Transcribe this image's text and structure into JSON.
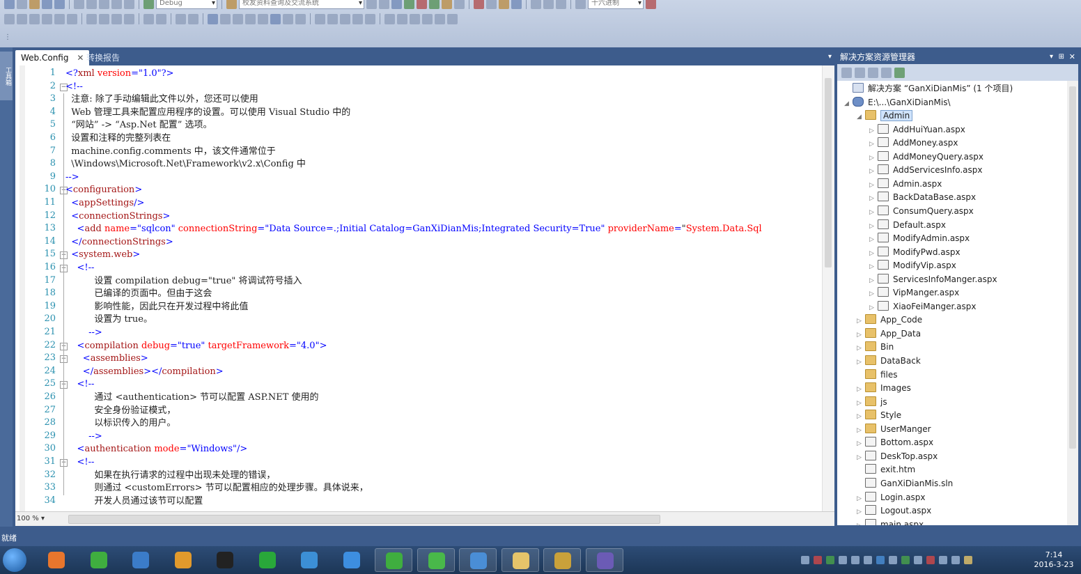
{
  "toolbar": {
    "config_combo": "Debug",
    "project_combo": "校友资料查询及交流系统",
    "mode_label": "十六进制"
  },
  "toolbox": {
    "label": "工具箱"
  },
  "editor": {
    "tabs": [
      {
        "label": "Web.Config",
        "close": "✕"
      },
      {
        "label": "转换报告"
      }
    ],
    "zoom": "100 %",
    "line_numbers": [
      "1",
      "2",
      "3",
      "4",
      "5",
      "6",
      "7",
      "8",
      "9",
      "10",
      "11",
      "12",
      "13",
      "14",
      "15",
      "16",
      "17",
      "18",
      "19",
      "20",
      "21",
      "22",
      "23",
      "24",
      "25",
      "26",
      "27",
      "28",
      "29",
      "30",
      "31",
      "32",
      "33",
      "34"
    ],
    "lines": [
      "<?xml version=\"1.0\"?>",
      "<!--",
      "  注意: 除了手动编辑此文件以外，您还可以使用",
      "  Web 管理工具来配置应用程序的设置。可以使用 Visual Studio 中的",
      "  “网站” -> “Asp.Net 配置” 选项。",
      "  设置和注释的完整列表在",
      "  machine.config.comments 中，该文件通常位于",
      "  \\Windows\\Microsoft.Net\\Framework\\v2.x\\Config 中",
      "-->",
      "<configuration>",
      "  <appSettings/>",
      "  <connectionStrings>",
      "    <add name=\"sqlcon\" connectionString=\"Data Source=.;Initial Catalog=GanXiDianMis;Integrated Security=True\" providerName=\"System.Data.Sql",
      "  </connectionStrings>",
      "  <system.web>",
      "    <!--",
      "          设置 compilation debug=\"true\" 将调试符号插入",
      "          已编译的页面中。但由于这会",
      "          影响性能，因此只在开发过程中将此值",
      "          设置为 true。",
      "        -->",
      "    <compilation debug=\"true\" targetFramework=\"4.0\">",
      "      <assemblies>",
      "      </assemblies></compilation>",
      "    <!--",
      "          通过 <authentication> 节可以配置 ASP.NET 使用的",
      "          安全身份验证模式，",
      "          以标识传入的用户。",
      "        -->",
      "    <authentication mode=\"Windows\"/>",
      "    <!--",
      "          如果在执行请求的过程中出现未处理的错误，",
      "          则通过 <customErrors> 节可以配置相应的处理步骤。具体说来，",
      "          开发人员通过该节可以配置"
    ]
  },
  "solution_explorer": {
    "title": "解决方案资源管理器",
    "items": [
      {
        "label": "解决方案 “GanXiDianMis” (1 个项目)",
        "icon": "solution-icon",
        "level": 0,
        "arrow": ""
      },
      {
        "label": "E:\\...\\GanXiDianMis\\",
        "icon": "project-icon",
        "level": 1,
        "arrow": "◢"
      },
      {
        "label": "Admin",
        "icon": "folder-icon",
        "level": 2,
        "arrow": "◢",
        "selected": true
      },
      {
        "label": "AddHuiYuan.aspx",
        "icon": "page-icon",
        "level": 3,
        "arrow": "▷"
      },
      {
        "label": "AddMoney.aspx",
        "icon": "page-icon",
        "level": 3,
        "arrow": "▷"
      },
      {
        "label": "AddMoneyQuery.aspx",
        "icon": "page-icon",
        "level": 3,
        "arrow": "▷"
      },
      {
        "label": "AddServicesInfo.aspx",
        "icon": "page-icon",
        "level": 3,
        "arrow": "▷"
      },
      {
        "label": "Admin.aspx",
        "icon": "page-icon",
        "level": 3,
        "arrow": "▷"
      },
      {
        "label": "BackDataBase.aspx",
        "icon": "page-icon",
        "level": 3,
        "arrow": "▷"
      },
      {
        "label": "ConsumQuery.aspx",
        "icon": "page-icon",
        "level": 3,
        "arrow": "▷"
      },
      {
        "label": "Default.aspx",
        "icon": "page-icon",
        "level": 3,
        "arrow": "▷"
      },
      {
        "label": "ModifyAdmin.aspx",
        "icon": "page-icon",
        "level": 3,
        "arrow": "▷"
      },
      {
        "label": "ModifyPwd.aspx",
        "icon": "page-icon",
        "level": 3,
        "arrow": "▷"
      },
      {
        "label": "ModifyVip.aspx",
        "icon": "page-icon",
        "level": 3,
        "arrow": "▷"
      },
      {
        "label": "ServicesInfoManger.aspx",
        "icon": "page-icon",
        "level": 3,
        "arrow": "▷"
      },
      {
        "label": "VipManger.aspx",
        "icon": "page-icon",
        "level": 3,
        "arrow": "▷"
      },
      {
        "label": "XiaoFeiManger.aspx",
        "icon": "page-icon",
        "level": 3,
        "arrow": "▷"
      },
      {
        "label": "App_Code",
        "icon": "folder-icon",
        "level": 2,
        "arrow": "▷"
      },
      {
        "label": "App_Data",
        "icon": "folder-icon",
        "level": 2,
        "arrow": "▷"
      },
      {
        "label": "Bin",
        "icon": "folder-icon",
        "level": 2,
        "arrow": "▷"
      },
      {
        "label": "DataBack",
        "icon": "folder-icon",
        "level": 2,
        "arrow": "▷"
      },
      {
        "label": "files",
        "icon": "folder-icon",
        "level": 2,
        "arrow": ""
      },
      {
        "label": "Images",
        "icon": "folder-icon",
        "level": 2,
        "arrow": "▷"
      },
      {
        "label": "js",
        "icon": "folder-icon",
        "level": 2,
        "arrow": "▷"
      },
      {
        "label": "Style",
        "icon": "folder-icon",
        "level": 2,
        "arrow": "▷"
      },
      {
        "label": "UserManger",
        "icon": "folder-icon",
        "level": 2,
        "arrow": "▷"
      },
      {
        "label": "Bottom.aspx",
        "icon": "page-icon",
        "level": 2,
        "arrow": "▷"
      },
      {
        "label": "DeskTop.aspx",
        "icon": "page-icon",
        "level": 2,
        "arrow": "▷"
      },
      {
        "label": "exit.htm",
        "icon": "page-icon",
        "level": 2,
        "arrow": ""
      },
      {
        "label": "GanXiDianMis.sln",
        "icon": "page-icon",
        "level": 2,
        "arrow": ""
      },
      {
        "label": "Login.aspx",
        "icon": "page-icon",
        "level": 2,
        "arrow": "▷"
      },
      {
        "label": "Logout.aspx",
        "icon": "page-icon",
        "level": 2,
        "arrow": "▷"
      },
      {
        "label": "main.aspx",
        "icon": "page-icon",
        "level": 2,
        "arrow": "▷"
      }
    ]
  },
  "status": {
    "text": "就绪"
  },
  "taskbar": {
    "apps": [
      {
        "name": "firefox-icon",
        "color": "#e8762d"
      },
      {
        "name": "360-icon",
        "color": "#3fae3f"
      },
      {
        "name": "paw-icon",
        "color": "#3b7cc9"
      },
      {
        "name": "package-icon",
        "color": "#e29a2c"
      },
      {
        "name": "qq-icon",
        "color": "#222222"
      },
      {
        "name": "iqiyi-icon",
        "color": "#29a83a"
      },
      {
        "name": "bird-icon",
        "color": "#3c8fd6"
      },
      {
        "name": "ie-icon",
        "color": "#3d8ee0"
      },
      {
        "name": "360-browser-icon",
        "color": "#3fae3f"
      },
      {
        "name": "wechat-icon",
        "color": "#49b84a"
      },
      {
        "name": "cloud-icon",
        "color": "#4a8ed6"
      },
      {
        "name": "explorer-icon",
        "color": "#e5c46a"
      },
      {
        "name": "tools-icon",
        "color": "#c9a13a"
      },
      {
        "name": "visual-studio-icon",
        "color": "#6b5bb5"
      }
    ],
    "clock_time": "7:14",
    "clock_date": "2016-3-23"
  }
}
